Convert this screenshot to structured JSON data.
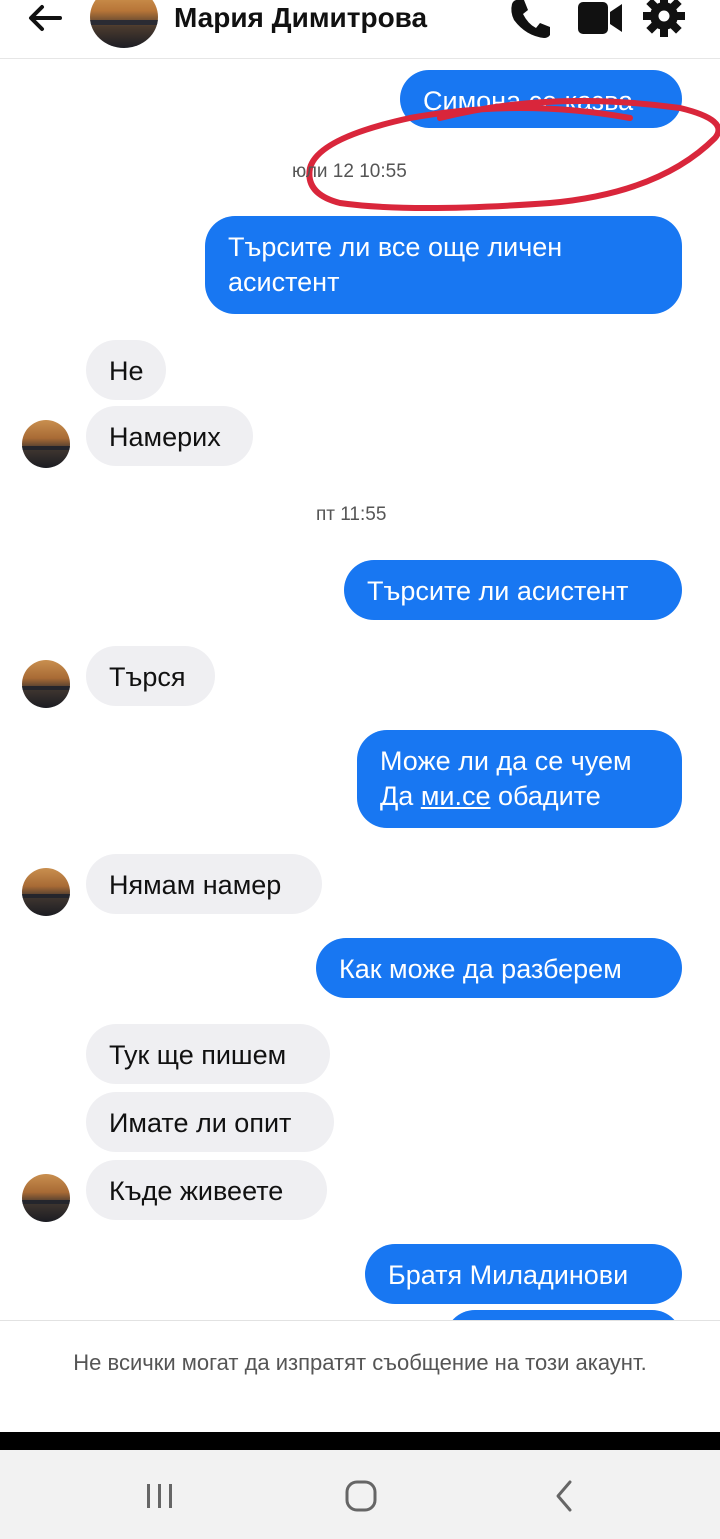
{
  "header": {
    "contact_name": "Мария Димитрова",
    "icons": [
      "back-arrow-icon",
      "phone-icon",
      "video-camera-icon",
      "gear-icon"
    ]
  },
  "messages": {
    "m1": "Симона се казва",
    "ts1": "юли 12 10:55",
    "m2_line1": "Търсите ли все още личен",
    "m2_line2": "асистент",
    "m3": "Не",
    "m4": "Намерих",
    "ts2": "пт 11:55",
    "m5": "Търсите ли асистент",
    "m6": "Търся",
    "m7_line1": "Може ли да се чуем",
    "m7_line2_a": "Да ",
    "m7_line2_link": "ми.се",
    "m7_line2_b": " обадите",
    "m8": "Нямам намер",
    "m9": "Как може да разберем",
    "m10": "Тук ще пишем",
    "m11": "Имате ли опит",
    "m12": "Къде живеете",
    "m13": "Братя Миладинови"
  },
  "footer": {
    "notice": "Не всички могат да изпратят съобщение на този акаунт."
  },
  "colors": {
    "outgoing_bubble": "#1877f2",
    "incoming_bubble": "#efeff2",
    "annotation": "#d9263b"
  },
  "navbar": {
    "icons": [
      "recent-apps-icon",
      "home-icon",
      "back-icon"
    ]
  }
}
